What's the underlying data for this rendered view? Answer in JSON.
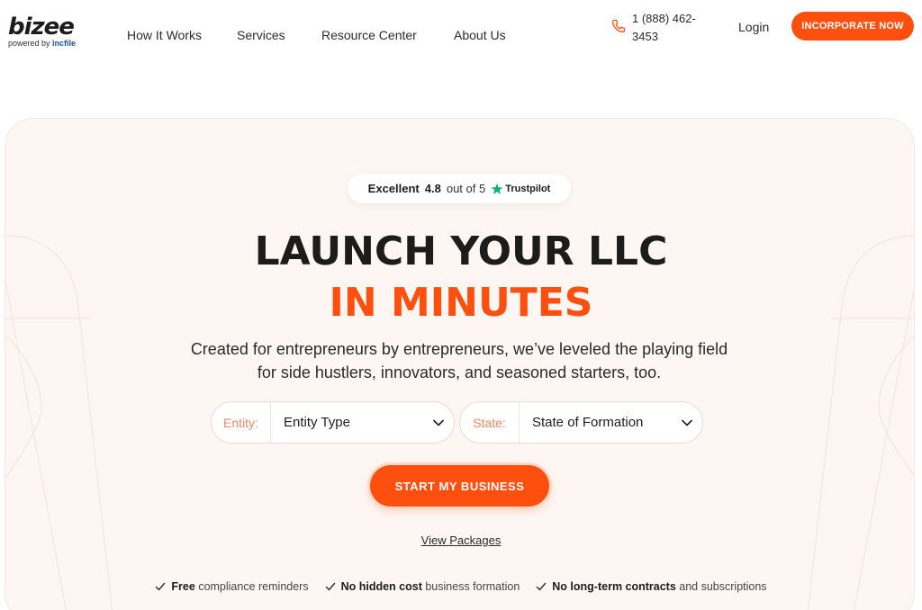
{
  "brand": {
    "name": "bizee",
    "powered_prefix": "powered by",
    "powered_brand": "incfile"
  },
  "nav": [
    {
      "label": "How It Works"
    },
    {
      "label": "Services"
    },
    {
      "label": "Resource Center"
    },
    {
      "label": "About Us"
    }
  ],
  "phone": {
    "icon": "phone-icon",
    "number": "1 (888) 462-3453"
  },
  "login_label": "Login",
  "cta_top_label": "INCORPORATE NOW",
  "trustpilot": {
    "rating_word": "Excellent",
    "score": "4.8",
    "out_of": "out of 5",
    "brand": "Trustpilot"
  },
  "hero": {
    "title_line1": "LAUNCH YOUR LLC",
    "title_line2": "IN MINUTES",
    "subtitle": "Created for entrepreneurs by entrepreneurs, we’ve leveled the playing field for side hustlers, innovators, and seasoned starters, too."
  },
  "form": {
    "entity": {
      "label": "Entity:",
      "value": "Entity Type"
    },
    "state": {
      "label": "State:",
      "value": "State of Formation"
    },
    "start_label": "START MY BUSINESS",
    "view_packages": "View Packages"
  },
  "features": [
    {
      "bold": "Free",
      "text": "compliance reminders"
    },
    {
      "bold": "No hidden cost",
      "text": "business formation"
    },
    {
      "bold": "No long-term contracts",
      "text": "and subscriptions"
    }
  ],
  "colors": {
    "accent": "#ff4f0f",
    "hero_bg": "#fdf6f2",
    "text": "#1c1c1c",
    "trustpilot_green": "#00b67a"
  }
}
